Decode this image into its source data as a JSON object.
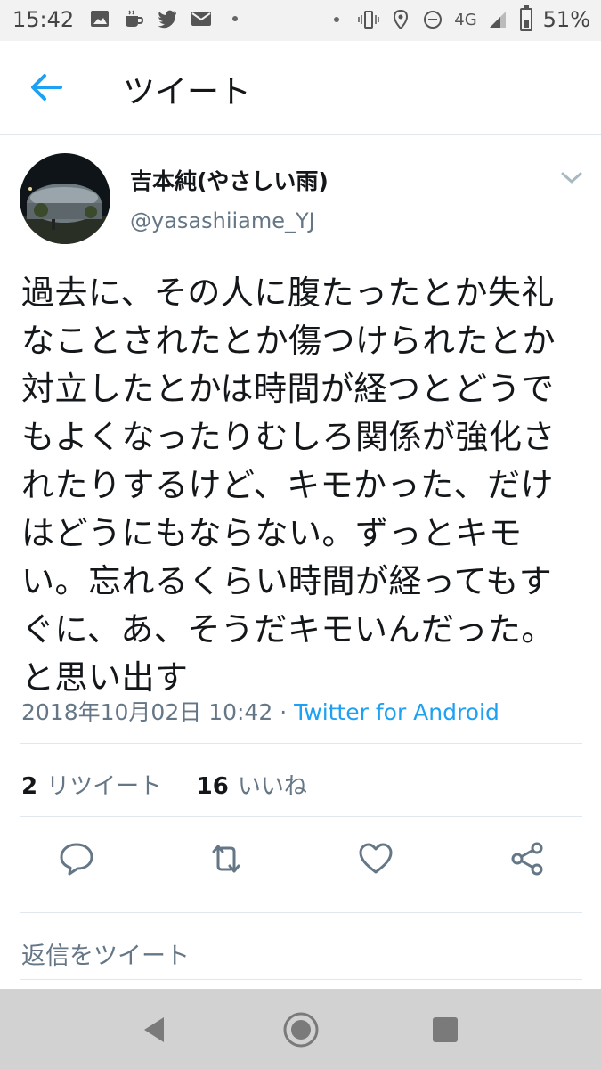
{
  "status_bar": {
    "time": "15:42",
    "left_icons": [
      "image-icon",
      "coffee-icon",
      "twitter-icon",
      "mail-icon",
      "dot-icon"
    ],
    "right_icons": [
      "dot-icon",
      "vibrate-icon",
      "location-icon",
      "dnd-icon",
      "signal-icon",
      "battery-icon"
    ],
    "network": "4G",
    "battery": "51%"
  },
  "header": {
    "title": "ツイート"
  },
  "tweet": {
    "author_name": "吉本純(やさしい雨)",
    "author_handle": "@yasashiiame_YJ",
    "text": "過去に、その人に腹たったとか失礼なことされたとか傷つけられたとか対立したとかは時間が経つとどうでもよくなったりむしろ関係が強化されたりするけど、キモかった、だけはどうにもならない。ずっとキモい。忘れるくらい時間が経ってもすぐに、あ、そうだキモいんだった。と思い出す",
    "timestamp": "2018年10月02日 10:42",
    "separator": "·",
    "source": "Twitter for Android",
    "retweet_count": "2",
    "retweet_label": "リツイート",
    "like_count": "16",
    "like_label": "いいね"
  },
  "reply": {
    "placeholder": "返信をツイート"
  },
  "colors": {
    "accent": "#1da1f2",
    "muted": "#657786",
    "text": "#14171a",
    "divider": "#e1e8ed"
  }
}
